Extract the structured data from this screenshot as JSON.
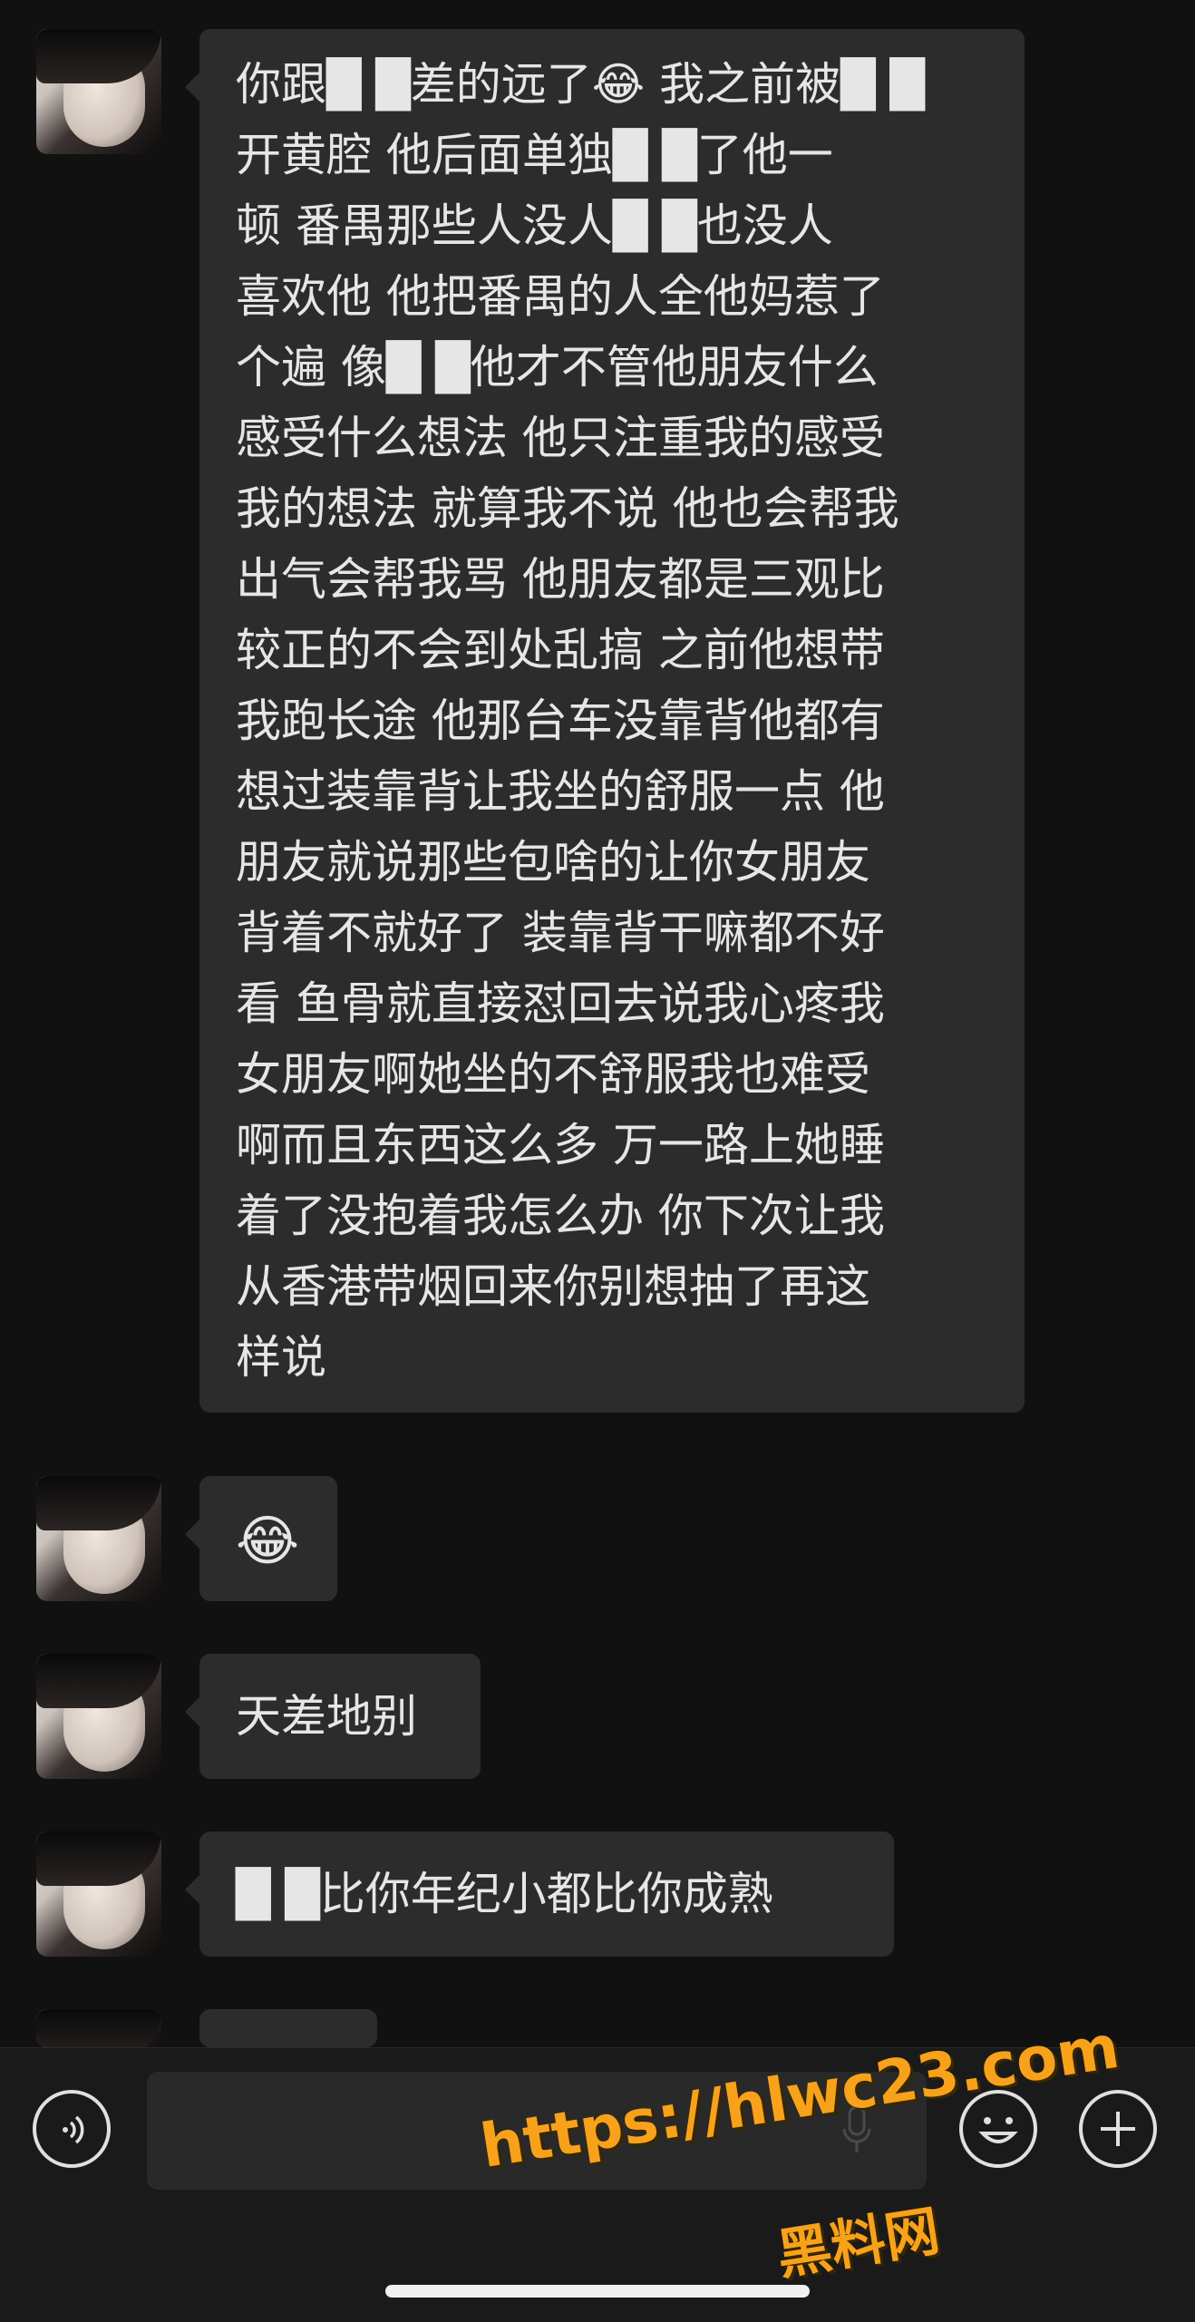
{
  "messages": [
    {
      "lines": [
        "你跟█ █差的远了😂 我之前被█ █",
        "开黄腔 他后面单独█ █了他一",
        "顿 番禺那些人没人█ █也没人",
        "喜欢他 他把番禺的人全他妈惹了",
        "个遍 像█ █他才不管他朋友什么",
        "感受什么想法 他只注重我的感受",
        "我的想法 就算我不说 他也会帮我",
        "出气会帮我骂 他朋友都是三观比",
        "较正的不会到处乱搞 之前他想带",
        "我跑长途 他那台车没靠背他都有",
        "想过装靠背让我坐的舒服一点 他",
        "朋友就说那些包啥的让你女朋友",
        "背着不就好了 装靠背干嘛都不好",
        "看 鱼骨就直接怼回去说我心疼我",
        "女朋友啊她坐的不舒服我也难受",
        "啊而且东西这么多 万一路上她睡",
        "着了没抱着我怎么办 你下次让我",
        "从香港带烟回来你别想抽了再这",
        "样说"
      ]
    },
    {
      "text": "😂"
    },
    {
      "text": "天差地别"
    },
    {
      "text": "█ █比你年纪小都比你成熟"
    },
    {
      "text": ""
    }
  ],
  "watermark": {
    "url": "https://hlwc23.com",
    "name": "黑料网"
  },
  "icons": {
    "voice": "voice-icon",
    "emoji": "emoji-icon",
    "plus": "plus-icon"
  }
}
